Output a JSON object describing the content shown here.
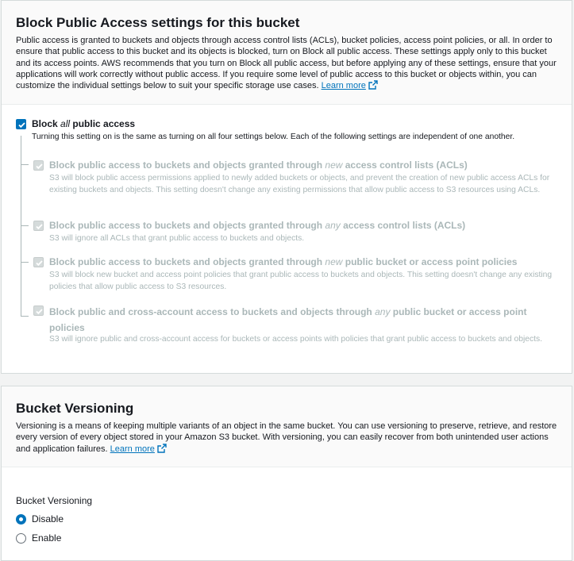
{
  "block_public_access": {
    "title": "Block Public Access settings for this bucket",
    "description": "Public access is granted to buckets and objects through access control lists (ACLs), bucket policies, access point policies, or all. In order to ensure that public access to this bucket and its objects is blocked, turn on Block all public access. These settings apply only to this bucket and its access points. AWS recommends that you turn on Block all public access, but before applying any of these settings, ensure that your applications will work correctly without public access. If you require some level of public access to this bucket or objects within, you can customize the individual settings below to suit your specific storage use cases.",
    "learn_more": "Learn more",
    "block_all": {
      "label_before": "Block ",
      "label_em": "all",
      "label_after": " public access",
      "checked": true,
      "description": "Turning this setting on is the same as turning on all four settings below. Each of the following settings are independent of one another."
    },
    "options": [
      {
        "label_before": "Block public access to buckets and objects granted through ",
        "label_em": "new",
        "label_after": " access control lists (ACLs)",
        "description": "S3 will block public access permissions applied to newly added buckets or objects, and prevent the creation of new public access ACLs for existing buckets and objects. This setting doesn't change any existing permissions that allow public access to S3 resources using ACLs.",
        "checked": true
      },
      {
        "label_before": "Block public access to buckets and objects granted through ",
        "label_em": "any",
        "label_after": " access control lists (ACLs)",
        "description": "S3 will ignore all ACLs that grant public access to buckets and objects.",
        "checked": true
      },
      {
        "label_before": "Block public access to buckets and objects granted through ",
        "label_em": "new",
        "label_after": " public bucket or access point policies",
        "description": "S3 will block new bucket and access point policies that grant public access to buckets and objects. This setting doesn't change any existing policies that allow public access to S3 resources.",
        "checked": true
      },
      {
        "label_before": "Block public and cross-account access to buckets and objects through ",
        "label_em": "any",
        "label_after": " public bucket or access point policies",
        "description": "S3 will ignore public and cross-account access for buckets or access points with policies that grant public access to buckets and objects.",
        "checked": true
      }
    ]
  },
  "versioning": {
    "title": "Bucket Versioning",
    "description": "Versioning is a means of keeping multiple variants of an object in the same bucket. You can use versioning to preserve, retrieve, and restore every version of every object stored in your Amazon S3 bucket. With versioning, you can easily recover from both unintended user actions and application failures.",
    "learn_more": "Learn more",
    "field_label": "Bucket Versioning",
    "options": [
      {
        "label": "Disable",
        "selected": true
      },
      {
        "label": "Enable",
        "selected": false
      }
    ]
  },
  "colors": {
    "accent": "#0073bb",
    "disabled_text": "#aab7b8",
    "panel_header_bg": "#fafafa"
  },
  "icons": {
    "external": "external-link-icon",
    "check": "check-icon"
  }
}
